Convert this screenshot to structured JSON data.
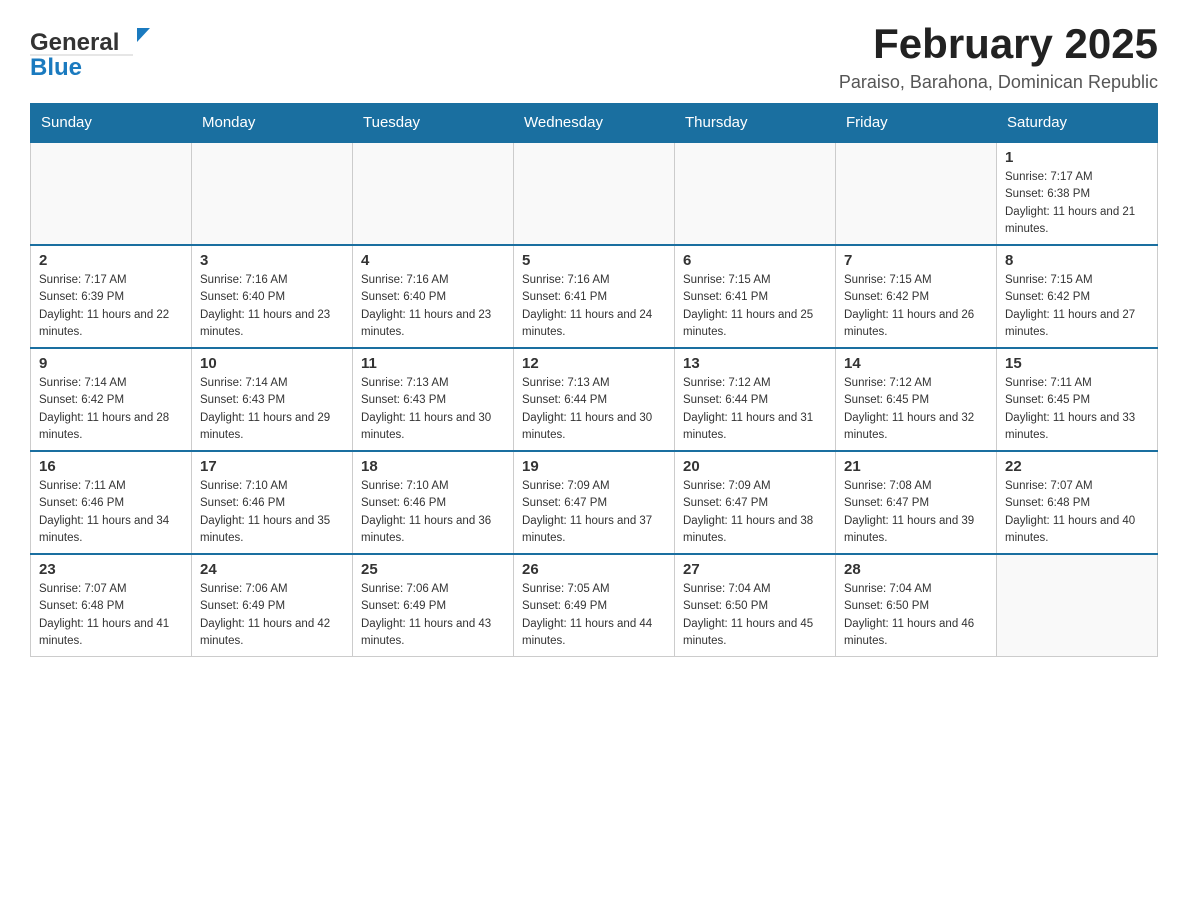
{
  "header": {
    "logo_general": "General",
    "logo_blue": "Blue",
    "month_title": "February 2025",
    "location": "Paraiso, Barahona, Dominican Republic"
  },
  "days_of_week": [
    "Sunday",
    "Monday",
    "Tuesday",
    "Wednesday",
    "Thursday",
    "Friday",
    "Saturday"
  ],
  "weeks": [
    [
      {
        "day": "",
        "info": ""
      },
      {
        "day": "",
        "info": ""
      },
      {
        "day": "",
        "info": ""
      },
      {
        "day": "",
        "info": ""
      },
      {
        "day": "",
        "info": ""
      },
      {
        "day": "",
        "info": ""
      },
      {
        "day": "1",
        "info": "Sunrise: 7:17 AM\nSunset: 6:38 PM\nDaylight: 11 hours and 21 minutes."
      }
    ],
    [
      {
        "day": "2",
        "info": "Sunrise: 7:17 AM\nSunset: 6:39 PM\nDaylight: 11 hours and 22 minutes."
      },
      {
        "day": "3",
        "info": "Sunrise: 7:16 AM\nSunset: 6:40 PM\nDaylight: 11 hours and 23 minutes."
      },
      {
        "day": "4",
        "info": "Sunrise: 7:16 AM\nSunset: 6:40 PM\nDaylight: 11 hours and 23 minutes."
      },
      {
        "day": "5",
        "info": "Sunrise: 7:16 AM\nSunset: 6:41 PM\nDaylight: 11 hours and 24 minutes."
      },
      {
        "day": "6",
        "info": "Sunrise: 7:15 AM\nSunset: 6:41 PM\nDaylight: 11 hours and 25 minutes."
      },
      {
        "day": "7",
        "info": "Sunrise: 7:15 AM\nSunset: 6:42 PM\nDaylight: 11 hours and 26 minutes."
      },
      {
        "day": "8",
        "info": "Sunrise: 7:15 AM\nSunset: 6:42 PM\nDaylight: 11 hours and 27 minutes."
      }
    ],
    [
      {
        "day": "9",
        "info": "Sunrise: 7:14 AM\nSunset: 6:42 PM\nDaylight: 11 hours and 28 minutes."
      },
      {
        "day": "10",
        "info": "Sunrise: 7:14 AM\nSunset: 6:43 PM\nDaylight: 11 hours and 29 minutes."
      },
      {
        "day": "11",
        "info": "Sunrise: 7:13 AM\nSunset: 6:43 PM\nDaylight: 11 hours and 30 minutes."
      },
      {
        "day": "12",
        "info": "Sunrise: 7:13 AM\nSunset: 6:44 PM\nDaylight: 11 hours and 30 minutes."
      },
      {
        "day": "13",
        "info": "Sunrise: 7:12 AM\nSunset: 6:44 PM\nDaylight: 11 hours and 31 minutes."
      },
      {
        "day": "14",
        "info": "Sunrise: 7:12 AM\nSunset: 6:45 PM\nDaylight: 11 hours and 32 minutes."
      },
      {
        "day": "15",
        "info": "Sunrise: 7:11 AM\nSunset: 6:45 PM\nDaylight: 11 hours and 33 minutes."
      }
    ],
    [
      {
        "day": "16",
        "info": "Sunrise: 7:11 AM\nSunset: 6:46 PM\nDaylight: 11 hours and 34 minutes."
      },
      {
        "day": "17",
        "info": "Sunrise: 7:10 AM\nSunset: 6:46 PM\nDaylight: 11 hours and 35 minutes."
      },
      {
        "day": "18",
        "info": "Sunrise: 7:10 AM\nSunset: 6:46 PM\nDaylight: 11 hours and 36 minutes."
      },
      {
        "day": "19",
        "info": "Sunrise: 7:09 AM\nSunset: 6:47 PM\nDaylight: 11 hours and 37 minutes."
      },
      {
        "day": "20",
        "info": "Sunrise: 7:09 AM\nSunset: 6:47 PM\nDaylight: 11 hours and 38 minutes."
      },
      {
        "day": "21",
        "info": "Sunrise: 7:08 AM\nSunset: 6:47 PM\nDaylight: 11 hours and 39 minutes."
      },
      {
        "day": "22",
        "info": "Sunrise: 7:07 AM\nSunset: 6:48 PM\nDaylight: 11 hours and 40 minutes."
      }
    ],
    [
      {
        "day": "23",
        "info": "Sunrise: 7:07 AM\nSunset: 6:48 PM\nDaylight: 11 hours and 41 minutes."
      },
      {
        "day": "24",
        "info": "Sunrise: 7:06 AM\nSunset: 6:49 PM\nDaylight: 11 hours and 42 minutes."
      },
      {
        "day": "25",
        "info": "Sunrise: 7:06 AM\nSunset: 6:49 PM\nDaylight: 11 hours and 43 minutes."
      },
      {
        "day": "26",
        "info": "Sunrise: 7:05 AM\nSunset: 6:49 PM\nDaylight: 11 hours and 44 minutes."
      },
      {
        "day": "27",
        "info": "Sunrise: 7:04 AM\nSunset: 6:50 PM\nDaylight: 11 hours and 45 minutes."
      },
      {
        "day": "28",
        "info": "Sunrise: 7:04 AM\nSunset: 6:50 PM\nDaylight: 11 hours and 46 minutes."
      },
      {
        "day": "",
        "info": ""
      }
    ]
  ]
}
